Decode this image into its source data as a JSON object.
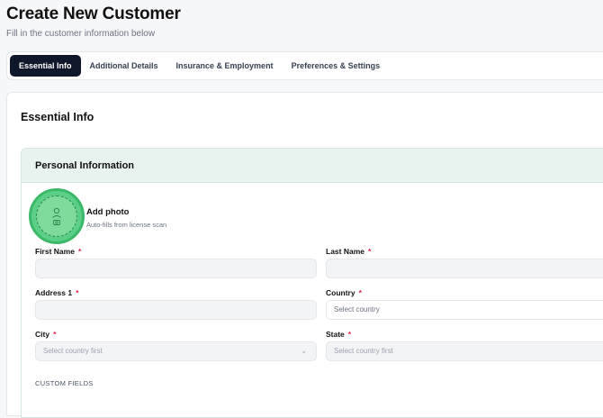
{
  "page": {
    "title": "Create New Customer",
    "subtitle": "Fill in the customer information below"
  },
  "tabs": [
    {
      "label": "Essential Info",
      "active": true
    },
    {
      "label": "Additional Details",
      "active": false
    },
    {
      "label": "Insurance & Employment",
      "active": false
    },
    {
      "label": "Preferences & Settings",
      "active": false
    }
  ],
  "card": {
    "title": "Essential Info"
  },
  "section": {
    "title": "Personal Information"
  },
  "photo": {
    "title": "Add photo",
    "hint": "Auto-fills from license scan"
  },
  "fields": {
    "first_name": {
      "label": "First Name",
      "required": "*",
      "value": ""
    },
    "last_name": {
      "label": "Last Name",
      "required": "*",
      "value": ""
    },
    "address1": {
      "label": "Address 1",
      "required": "*",
      "value": ""
    },
    "country": {
      "label": "Country",
      "required": "*",
      "placeholder": "Select country"
    },
    "city": {
      "label": "City",
      "required": "*",
      "placeholder": "Select country first"
    },
    "state": {
      "label": "State",
      "required": "*",
      "placeholder": "Select country first"
    }
  },
  "custom_fields_label": "CUSTOM FIELDS",
  "colors": {
    "active_tab": "#0f172a",
    "section_header": "#e8f3ef",
    "required": "#e11d48",
    "photo_highlight": "#5ccf86"
  }
}
